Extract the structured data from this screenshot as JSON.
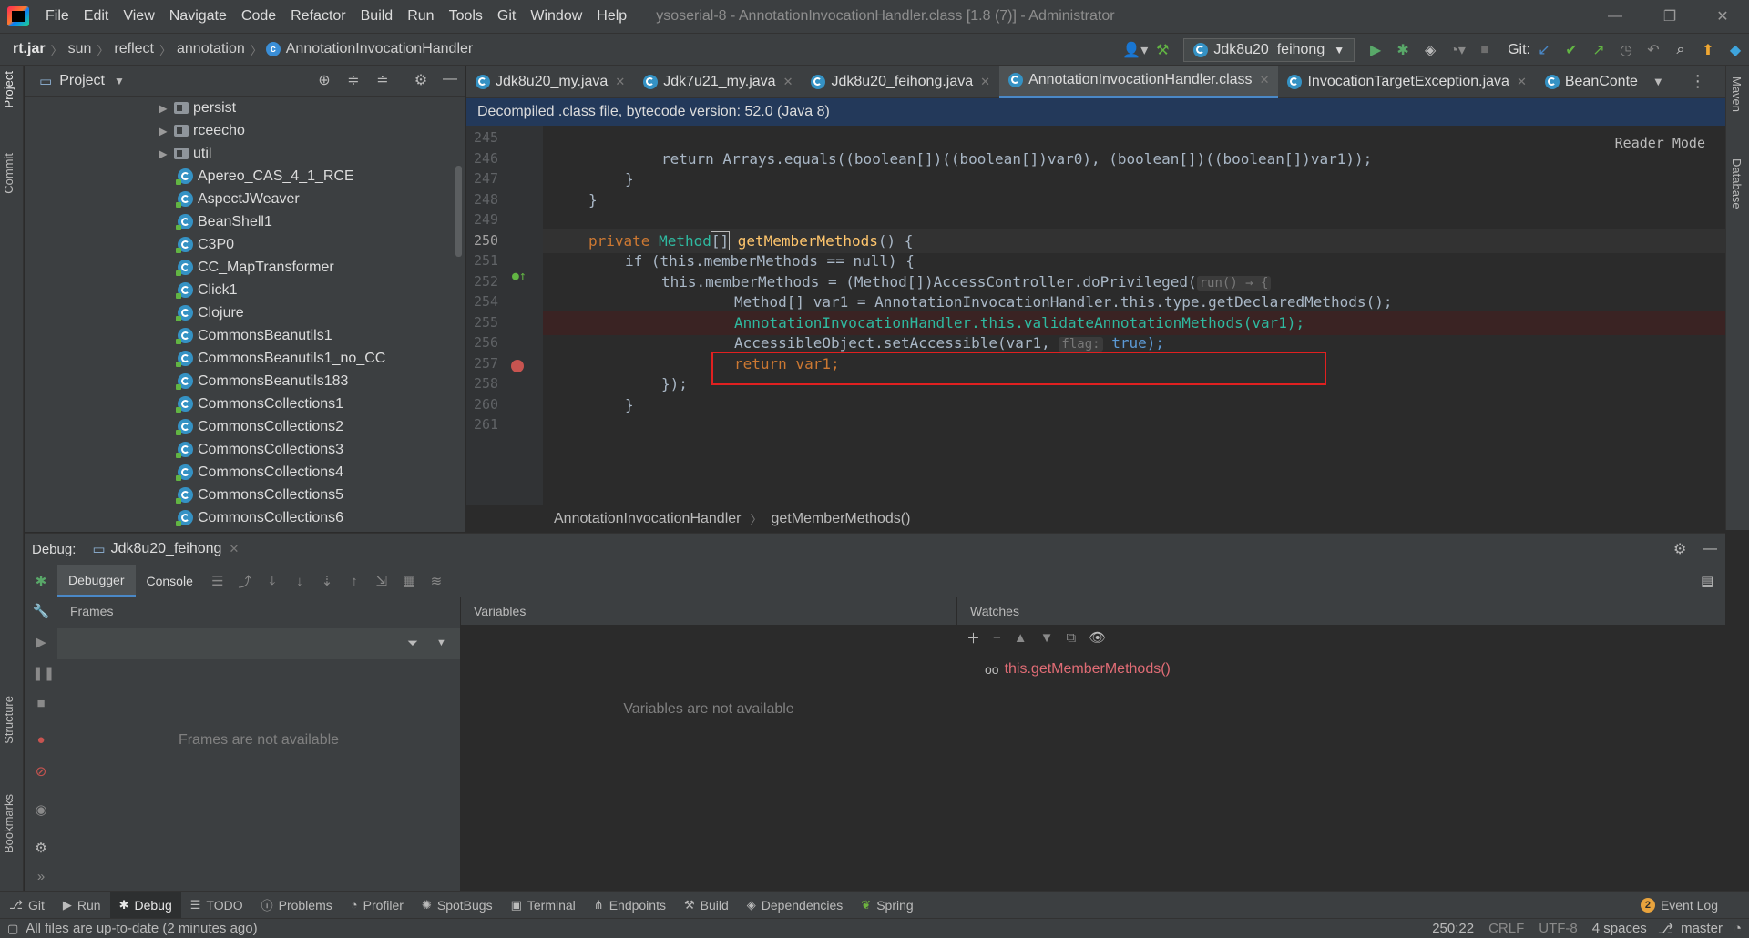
{
  "window": {
    "title": "ysoserial-8 - AnnotationInvocationHandler.class [1.8 (7)] - Administrator",
    "menu": [
      "File",
      "Edit",
      "View",
      "Navigate",
      "Code",
      "Refactor",
      "Build",
      "Run",
      "Tools",
      "Git",
      "Window",
      "Help"
    ]
  },
  "nav": {
    "breadcrumb": [
      "rt.jar",
      "sun",
      "reflect",
      "annotation",
      "AnnotationInvocationHandler"
    ],
    "run_config": "Jdk8u20_feihong",
    "git_label": "Git:"
  },
  "left_strip": {
    "project": "Project",
    "commit": "Commit",
    "structure": "Structure",
    "bookmarks": "Bookmarks"
  },
  "right_strip": {
    "maven": "Maven",
    "database": "Database"
  },
  "project": {
    "title": "Project",
    "folders": [
      "persist",
      "rceecho",
      "util"
    ],
    "classes": [
      "Apereo_CAS_4_1_RCE",
      "AspectJWeaver",
      "BeanShell1",
      "C3P0",
      "CC_MapTransformer",
      "Click1",
      "Clojure",
      "CommonsBeanutils1",
      "CommonsBeanutils1_no_CC",
      "CommonsBeanutils183",
      "CommonsCollections1",
      "CommonsCollections2",
      "CommonsCollections3",
      "CommonsCollections4",
      "CommonsCollections5",
      "CommonsCollections6"
    ]
  },
  "editor": {
    "tabs": [
      "Jdk8u20_my.java",
      "Jdk7u21_my.java",
      "Jdk8u20_feihong.java",
      "AnnotationInvocationHandler.class",
      "InvocationTargetException.java",
      "BeanConte"
    ],
    "active_tab": "AnnotationInvocationHandler.class",
    "banner": "Decompiled .class file, bytecode version: 52.0 (Java 8)",
    "reader_mode": "Reader Mode",
    "line_numbers": [
      "245",
      "246",
      "247",
      "248",
      "249",
      "250",
      "251",
      "252",
      "254",
      "255",
      "256",
      "257",
      "258",
      "260",
      "261"
    ],
    "code": {
      "l246": "return Arrays.equals((boolean[])((boolean[])var0), (boolean[])((boolean[])var1));",
      "l250_a": "private ",
      "l250_b": "Method",
      "l250_c": "[]",
      "l250_d": " getMemberMethods",
      "l250_e": "() {",
      "l251": "if (this.memberMethods == null) {",
      "l252_a": "this.memberMethods = (Method[])AccessController.doPrivileged(",
      "l252_hint": "run() → {",
      "l254": "Method[] var1 = AnnotationInvocationHandler.this.type.getDeclaredMethods();",
      "l255": "AnnotationInvocationHandler.this.validateAnnotationMethods(var1);",
      "l256_a": "AccessibleObject.setAccessible(var1, ",
      "l256_hint": "flag:",
      "l256_b": " true);",
      "l257": "return var1;",
      "l258": "});",
      "close": "}"
    },
    "breadcrumb": [
      "AnnotationInvocationHandler",
      "getMemberMethods()"
    ]
  },
  "debug": {
    "label": "Debug:",
    "session": "Jdk8u20_feihong",
    "tabs": [
      "Debugger",
      "Console"
    ],
    "frames_title": "Frames",
    "frames_empty": "Frames are not available",
    "variables_title": "Variables",
    "variables_empty": "Variables are not available",
    "watches_title": "Watches",
    "watch_expr": "this.getMemberMethods()"
  },
  "toolwindows": [
    "Git",
    "Run",
    "Debug",
    "TODO",
    "Problems",
    "Profiler",
    "SpotBugs",
    "Terminal",
    "Endpoints",
    "Build",
    "Dependencies",
    "Spring"
  ],
  "event_log": {
    "count": "2",
    "label": "Event Log"
  },
  "status": {
    "message": "All files are up-to-date (2 minutes ago)",
    "position": "250:22",
    "line_sep": "CRLF",
    "encoding": "UTF-8",
    "indent": "4 spaces",
    "branch": "master"
  },
  "colors": {
    "accent": "#4a88c7",
    "breakpoint": "#c75450",
    "highlight_box": "#e02020"
  }
}
